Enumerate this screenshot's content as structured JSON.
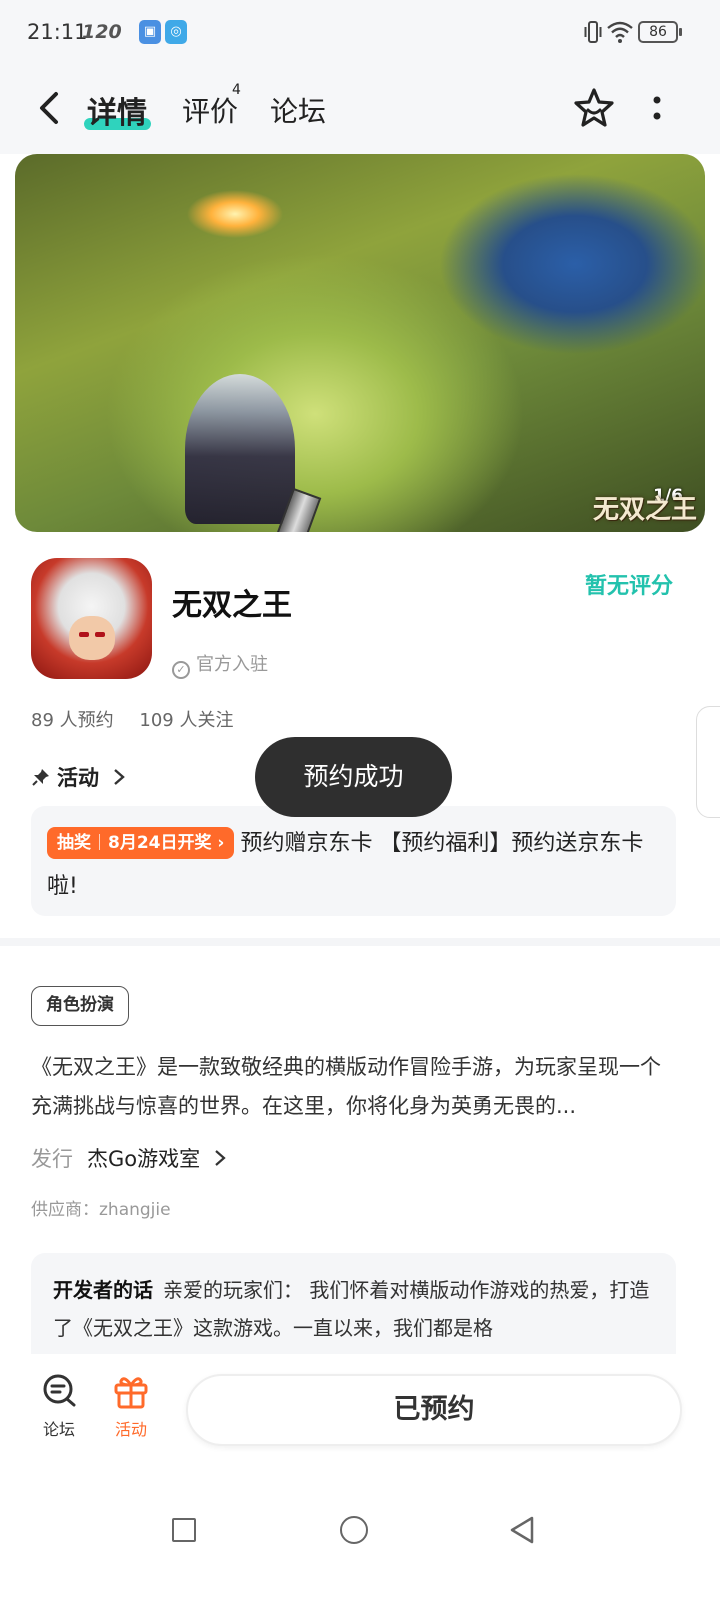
{
  "status_bar": {
    "time": "21:11",
    "refresh_rate": "120",
    "battery": "86"
  },
  "nav": {
    "tabs": {
      "detail": "详情",
      "review": "评价",
      "review_badge": "4",
      "forum": "论坛"
    },
    "active_tab": "详情",
    "accent_color": "#2fd3bd"
  },
  "banner": {
    "counter": "1/6",
    "logo_text": "无双之王"
  },
  "app": {
    "name": "无双之王",
    "official_label": "官方入驻",
    "rating_text": "暂无评分",
    "rating_color": "#23c2ad",
    "reservations": "89 人预约",
    "followers": "109 人关注"
  },
  "activity": {
    "heading": "活动",
    "tag_type": "抽奖",
    "tag_date": "8月24日开奖",
    "text": "预约赠京东卡 【预约福利】预约送京东卡啦!",
    "tag_color": "#ff6a2a"
  },
  "toast": {
    "text": "预约成功"
  },
  "details": {
    "genre": "角色扮演",
    "description": "《无双之王》是一款致敬经典的横版动作冒险手游，为玩家呈现一个充满挑战与惊喜的世界。在这里，你将化身为英勇无畏的...",
    "publisher_label": "发行",
    "publisher_name": "杰Go游戏室",
    "supplier": "供应商：zhangjie"
  },
  "developer_note": {
    "title": "开发者的话",
    "text": "亲爱的玩家们：  我们怀着对横版动作游戏的热爱，打造了《无双之王》这款游戏。一直以来，我们都是格"
  },
  "bottom_bar": {
    "forum_label": "论坛",
    "activity_label": "活动",
    "reserved_button": "已预约"
  }
}
